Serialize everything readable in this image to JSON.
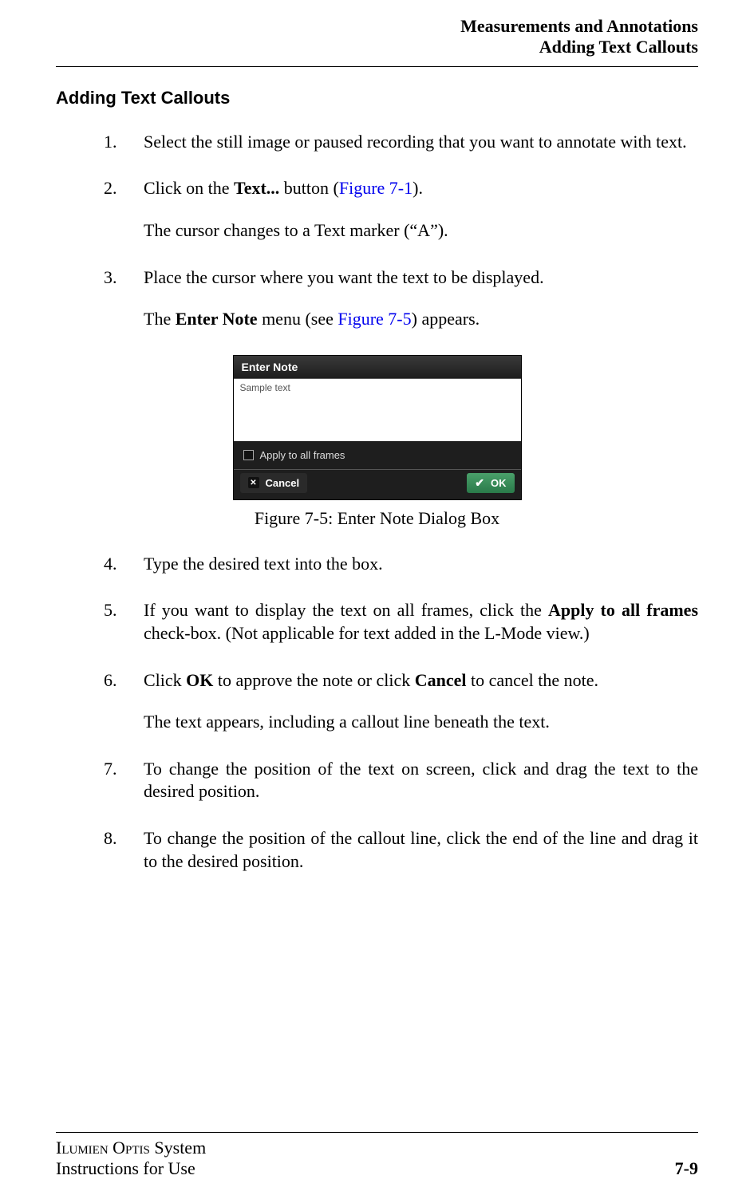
{
  "header": {
    "line1": "Measurements and Annotations",
    "line2": "Adding Text Callouts"
  },
  "section_heading": "Adding Text Callouts",
  "steps": {
    "s1": {
      "num": "1.",
      "text": "Select the still image or paused recording that you want to annotate with text."
    },
    "s2": {
      "num": "2.",
      "pre": "Click on the ",
      "bold": "Text...",
      "mid": " button (",
      "link": "Figure 7-1",
      "post": ").",
      "sub": "The cursor changes to a Text marker (“A”)."
    },
    "s3": {
      "num": "3.",
      "text": "Place the cursor where you want the text to be displayed.",
      "sub_pre": "The ",
      "sub_bold": "Enter Note",
      "sub_mid": " menu (see ",
      "sub_link": "Figure 7-5",
      "sub_post": ") appears."
    },
    "s4": {
      "num": "4.",
      "text": "Type the desired text into the box."
    },
    "s5": {
      "num": "5.",
      "pre": "If you want to display the text on all frames, click the ",
      "bold": "Apply to all frames",
      "post": " check-box. (Not applicable for text added in the L-Mode view.)"
    },
    "s6": {
      "num": "6.",
      "pre": "Click ",
      "bold1": "OK",
      "mid": " to approve the note or click ",
      "bold2": "Cancel",
      "post": " to cancel the note.",
      "sub": "The text appears, including a callout line beneath the text."
    },
    "s7": {
      "num": "7.",
      "text": "To change the position of the text on screen, click and drag the text to the desired position."
    },
    "s8": {
      "num": "8.",
      "text": "To change the position of the callout line, click the end of the line and drag it to the desired position."
    }
  },
  "dialog": {
    "title": "Enter Note",
    "sample_text": "Sample text",
    "checkbox_label": "Apply to all frames",
    "cancel_label": "Cancel",
    "ok_label": "OK"
  },
  "figure_caption": "Figure 7-5:  Enter Note Dialog Box",
  "footer": {
    "product_sc1": "Ilumien",
    "product_sc2": "Optis",
    "product_rest": " System",
    "line2": "Instructions for Use",
    "page": "7-9"
  }
}
